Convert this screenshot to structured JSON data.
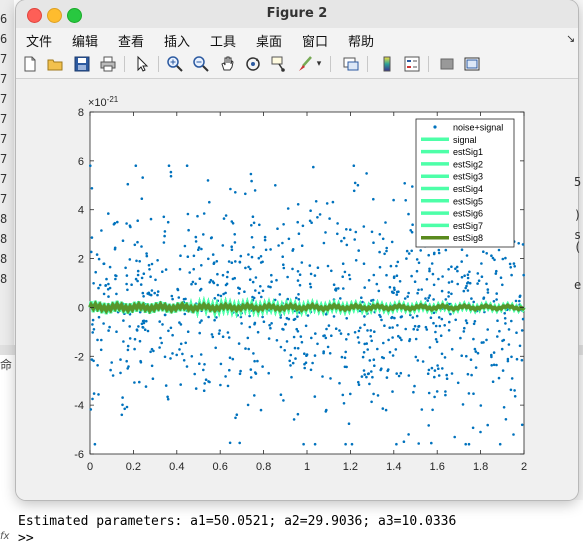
{
  "window": {
    "title": "Figure 2"
  },
  "menu": [
    "文件",
    "编辑",
    "查看",
    "插入",
    "工具",
    "桌面",
    "窗口",
    "帮助"
  ],
  "toolbar_icons": [
    "new-figure-icon",
    "open-file-icon",
    "save-icon",
    "print-icon",
    "pointer-icon",
    "zoom-in-icon",
    "zoom-out-icon",
    "pan-icon",
    "rotate-3d-icon",
    "data-cursor-icon",
    "brush-icon",
    "brush-dropdown-icon",
    "link-plot-icon",
    "colorbar-icon",
    "legend-icon",
    "hide-plot-tools-icon",
    "show-plot-tools-icon"
  ],
  "background": {
    "gutter_digits": [
      "6",
      "6",
      "7",
      "7",
      "7",
      "7",
      "7",
      "7",
      "7",
      "7",
      "8",
      "8",
      "8",
      "8"
    ],
    "right_fragments": [
      "5",
      ")",
      "s",
      "(",
      "e"
    ],
    "cmd_label": "命",
    "console_line": "Estimated parameters: a1=50.0521; a2=29.9036; a3=10.0336",
    "prompt": ">>",
    "fx": "fx"
  },
  "chart_data": {
    "type": "scatter",
    "exponent_label": "×10",
    "exponent_power": "-21",
    "xlim": [
      0,
      2
    ],
    "ylim": [
      -6,
      8
    ],
    "xticks": [
      "0",
      "0.2",
      "0.4",
      "0.6",
      "0.8",
      "1",
      "1.2",
      "1.4",
      "1.6",
      "1.8",
      "2"
    ],
    "yticks": [
      "-6",
      "-4",
      "-2",
      "0",
      "2",
      "4",
      "6",
      "8"
    ],
    "legend_position": "top-right",
    "series": [
      {
        "name": "noise+signal",
        "type": "scatter",
        "color": "#0072bd",
        "count": 1000,
        "spread": 2.3,
        "x_range": [
          0,
          2
        ]
      },
      {
        "name": "signal",
        "type": "line",
        "color": "#4dffa8"
      },
      {
        "name": "estSig1",
        "type": "line",
        "color": "#4dffa8"
      },
      {
        "name": "estSig2",
        "type": "line",
        "color": "#4dffa8"
      },
      {
        "name": "estSig3",
        "type": "line",
        "color": "#4dffa8"
      },
      {
        "name": "estSig4",
        "type": "line",
        "color": "#4dffa8"
      },
      {
        "name": "estSig5",
        "type": "line",
        "color": "#4dffa8"
      },
      {
        "name": "estSig6",
        "type": "line",
        "color": "#4dffa8"
      },
      {
        "name": "estSig7",
        "type": "line",
        "color": "#4dffa8"
      },
      {
        "name": "estSig8",
        "type": "line",
        "color": "#5a8a1e"
      }
    ]
  }
}
